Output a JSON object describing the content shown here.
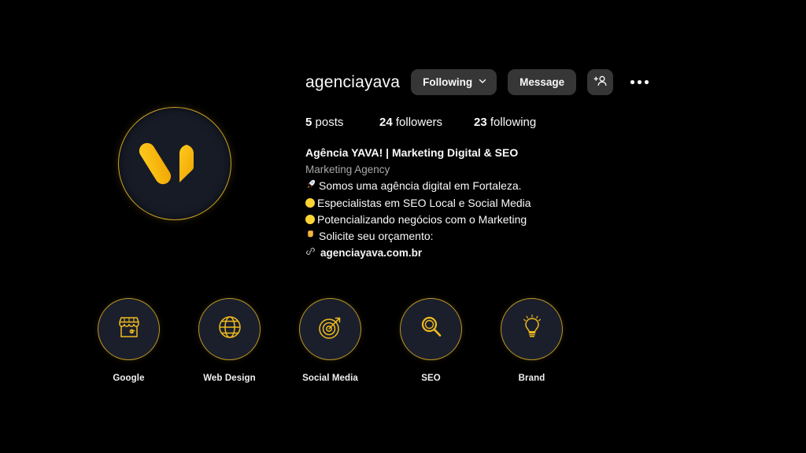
{
  "profile": {
    "username": "agenciayava",
    "avatar_icon": "yava-logo-icon",
    "accent_gold": "#F5BE19",
    "avatar_bg": "#161B26"
  },
  "actions": {
    "following_label": "Following",
    "following_chevron": "chevron-down-icon",
    "message_label": "Message",
    "add_person_icon": "add-person-icon",
    "more_options_icon": "more-options-icon"
  },
  "stats": [
    {
      "value": "5",
      "label": "posts",
      "name": "posts"
    },
    {
      "value": "24",
      "label": "followers",
      "name": "followers"
    },
    {
      "value": "23",
      "label": "following",
      "name": "following"
    }
  ],
  "bio": {
    "display_name": "Agência YAVA! | Marketing Digital & SEO",
    "category": "Marketing Agency",
    "lines": [
      {
        "emoji": "rocket",
        "text": "Somos uma agência digital em Fortaleza."
      },
      {
        "emoji": "yellow-circle",
        "text": "Especialistas em SEO Local e Social Media"
      },
      {
        "emoji": "yellow-circle",
        "text": "Potencializando negócios com o Marketing"
      },
      {
        "emoji": "point-down",
        "text": "Solicite seu orçamento:"
      }
    ],
    "link": {
      "icon": "link-icon",
      "text": "agenciayava.com.br"
    }
  },
  "highlights": [
    {
      "label": "Google",
      "icon": "storefront-g-icon"
    },
    {
      "label": "Web Design",
      "icon": "globe-icon"
    },
    {
      "label": "Social Media",
      "icon": "target-arrow-icon"
    },
    {
      "label": "SEO",
      "icon": "magnifier-icon"
    },
    {
      "label": "Brand",
      "icon": "lightbulb-icon"
    }
  ]
}
